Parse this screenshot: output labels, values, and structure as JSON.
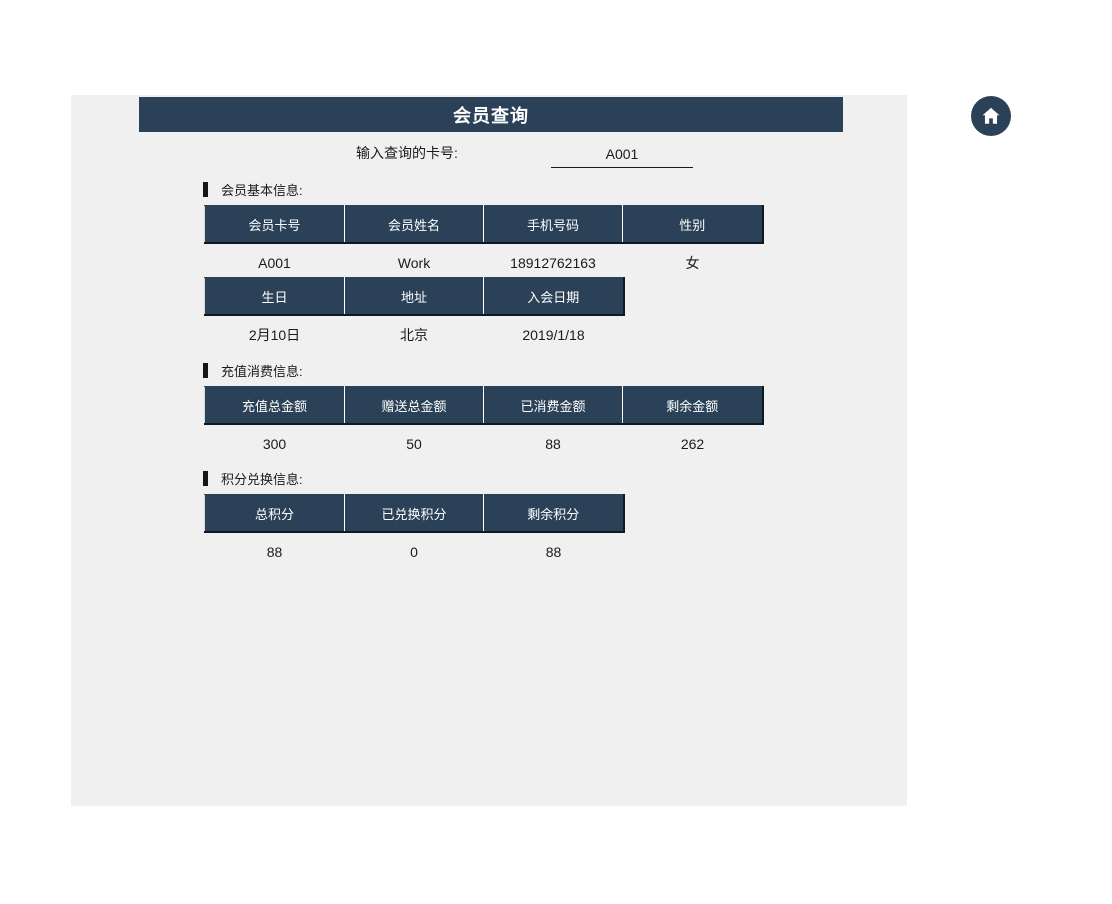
{
  "header": {
    "title": "会员查询"
  },
  "query": {
    "label": "输入查询的卡号:",
    "value": "A001",
    "placeholder": "A001"
  },
  "home_button": {
    "icon": "home-icon",
    "color": "#2a4158"
  },
  "theme": {
    "header_bg": "#2a4158",
    "panel_bg": "#f0f0f0",
    "page_bg": "#ffffff",
    "header_text": "#ffffff",
    "body_text": "#1a1a1a"
  },
  "sections": [
    {
      "label": "会员基本信息:",
      "tables": [
        {
          "name": "basic-info-primary",
          "columns": [
            "会员卡号",
            "会员姓名",
            "手机号码",
            "性别"
          ],
          "rows": [
            [
              "A001",
              "Work",
              "18912762163",
              "女"
            ]
          ]
        },
        {
          "name": "basic-info-secondary",
          "columns": [
            "生日",
            "地址",
            "入会日期"
          ],
          "rows": [
            [
              "2月10日",
              "北京",
              "2019/1/18"
            ]
          ]
        }
      ]
    },
    {
      "label": "充值消费信息:",
      "tables": [
        {
          "name": "recharge-consumption",
          "columns": [
            "充值总金额",
            "赠送总金额",
            "已消费金额",
            "剩余金额"
          ],
          "rows": [
            [
              "300",
              "50",
              "88",
              "262"
            ]
          ]
        }
      ]
    },
    {
      "label": "积分兑换信息:",
      "tables": [
        {
          "name": "points-exchange",
          "columns": [
            "总积分",
            "已兑换积分",
            "剩余积分"
          ],
          "rows": [
            [
              "88",
              "0",
              "88"
            ]
          ]
        }
      ]
    }
  ]
}
